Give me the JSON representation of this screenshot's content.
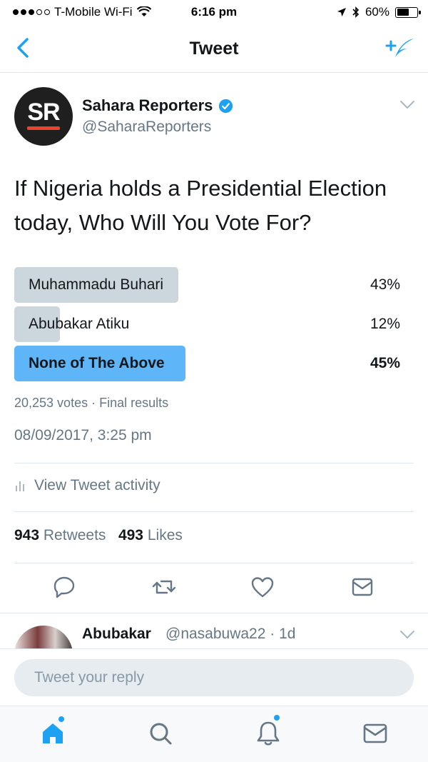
{
  "status_bar": {
    "carrier": "T-Mobile Wi-Fi",
    "time": "6:16 pm",
    "battery": "60%",
    "battery_level": 0.6
  },
  "nav": {
    "title": "Tweet",
    "back_icon": "chevron-left-icon",
    "compose_icon": "compose-tweet-icon"
  },
  "tweet": {
    "author": {
      "avatar_text": "SR",
      "name": "Sahara Reporters",
      "handle": "@SaharaReporters",
      "verified": true
    },
    "text": "If Nigeria holds a Presidential Election today, Who Will You Vote For?",
    "poll": {
      "options": [
        {
          "label": "Muhammadu Buhari",
          "percent": "43%",
          "value": 43,
          "winner": false
        },
        {
          "label": "Abubakar Atiku",
          "percent": "12%",
          "value": 12,
          "winner": false
        },
        {
          "label": "None of The Above",
          "percent": "45%",
          "value": 45,
          "winner": true
        }
      ],
      "votes": "20,253 votes",
      "separator": "·",
      "status": "Final results"
    },
    "timestamp": "08/09/2017, 3:25 pm",
    "activity_label": "View Tweet activity",
    "retweets_count": "943",
    "retweets_label": "Retweets",
    "likes_count": "493",
    "likes_label": "Likes"
  },
  "reply_preview": {
    "name": "Abubakar",
    "handle": "@nasabuwa22",
    "time": "· 1d"
  },
  "reply_bar": {
    "placeholder": "Tweet your reply"
  },
  "colors": {
    "accent": "#1da1f2",
    "poll_winner": "#5eb5f7",
    "poll_other": "#ccd6dd",
    "secondary_text": "#657786"
  }
}
